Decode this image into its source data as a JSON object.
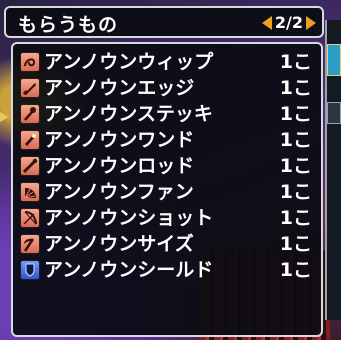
{
  "window": {
    "title": "もらうもの",
    "page": "2/2"
  },
  "items": [
    {
      "name": "アンノウンウィップ",
      "qty": "1こ",
      "icon": "whip-icon",
      "color": "#e8826c"
    },
    {
      "name": "アンノウンエッジ",
      "qty": "1こ",
      "icon": "edge-icon",
      "color": "#e8826c"
    },
    {
      "name": "アンノウンステッキ",
      "qty": "1こ",
      "icon": "stick-icon",
      "color": "#e8826c"
    },
    {
      "name": "アンノウンワンド",
      "qty": "1こ",
      "icon": "wand-icon",
      "color": "#e8826c"
    },
    {
      "name": "アンノウンロッド",
      "qty": "1こ",
      "icon": "rod-icon",
      "color": "#e8826c"
    },
    {
      "name": "アンノウンファン",
      "qty": "1こ",
      "icon": "fan-icon",
      "color": "#e8826c"
    },
    {
      "name": "アンノウンショット",
      "qty": "1こ",
      "icon": "bow-icon",
      "color": "#e8826c"
    },
    {
      "name": "アンノウンサイズ",
      "qty": "1こ",
      "icon": "scythe-icon",
      "color": "#e8826c"
    },
    {
      "name": "アンノウンシールド",
      "qty": "1こ",
      "icon": "shield-icon",
      "color": "#3d6cf0"
    }
  ]
}
